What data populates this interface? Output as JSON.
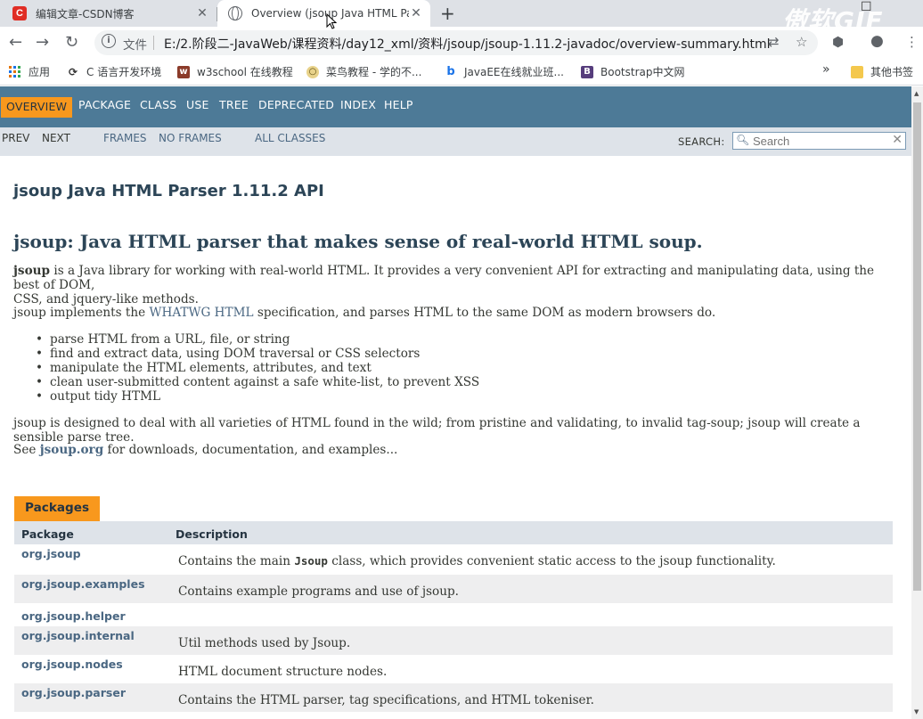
{
  "browser": {
    "tabs": [
      {
        "title": "编辑文章-CSDN博客",
        "icon": "csdn-icon",
        "active": false
      },
      {
        "title": "Overview (jsoup Java HTML Pa",
        "icon": "globe-icon",
        "active": true
      }
    ],
    "address": {
      "security_label": "文件",
      "url": "E:/2.阶段二-JavaWeb/课程资料/day12_xml/资料/jsoup/jsoup-1.11.2-javadoc/overview-summary.html"
    },
    "bookmarks": [
      {
        "label": "应用",
        "icon": "apps-grid-icon"
      },
      {
        "label": "C 语言开发环境",
        "icon": "sync-icon"
      },
      {
        "label": "w3school 在线教程",
        "icon": "w3school-icon"
      },
      {
        "label": "菜鸟教程 - 学的不...",
        "icon": "runoob-icon"
      },
      {
        "label": "JavaEE在线就业班...",
        "icon": "bing-icon"
      },
      {
        "label": "Bootstrap中文网",
        "icon": "bootstrap-icon"
      }
    ],
    "bookmarks_more": "»",
    "other_bookmarks": "其他书签",
    "watermark": "傲软GIF"
  },
  "javadoc": {
    "topnav": [
      "OVERVIEW",
      "PACKAGE",
      "CLASS",
      "USE",
      "TREE",
      "DEPRECATED",
      "INDEX",
      "HELP"
    ],
    "subnav": {
      "prev": "PREV",
      "next": "NEXT",
      "frames": "FRAMES",
      "no_frames": "NO FRAMES",
      "all_classes": "ALL CLASSES",
      "search_label": "SEARCH:",
      "search_placeholder": "Search"
    },
    "title": "jsoup Java HTML Parser 1.11.2 API",
    "heading": "jsoup: Java HTML parser that makes sense of real-world HTML soup.",
    "intro": {
      "bold": "jsoup",
      "line1": " is a Java library for working with real-world HTML. It provides a very convenient API for extracting and manipulating data, using the best of DOM,",
      "line2": "CSS, and jquery-like methods."
    },
    "implements": {
      "before": "jsoup implements the ",
      "link": "WHATWG HTML",
      "after": " specification, and parses HTML to the same DOM as modern browsers do."
    },
    "features": [
      "parse HTML from a URL, file, or string",
      "find and extract data, using DOM traversal or CSS selectors",
      "manipulate the HTML elements, attributes, and text",
      "clean user-submitted content against a safe white-list, to prevent XSS",
      "output tidy HTML"
    ],
    "designed": "jsoup is designed to deal with all varieties of HTML found in the wild; from pristine and validating, to invalid tag-soup; jsoup will create a sensible parse tree.",
    "see": {
      "before": "See ",
      "link": "jsoup.org",
      "after": " for downloads, documentation, and examples..."
    },
    "packages": {
      "tab": "Packages",
      "col_package": "Package",
      "col_description": "Description",
      "rows": [
        {
          "name": "org.jsoup",
          "desc_before": "Contains the main ",
          "desc_code": "Jsoup",
          "desc_after": " class, which provides convenient static access to the jsoup functionality."
        },
        {
          "name": "org.jsoup.examples",
          "desc_before": "Contains example programs and use of jsoup.",
          "desc_code": "",
          "desc_after": ""
        },
        {
          "name": "org.jsoup.helper",
          "desc_before": "",
          "desc_code": "",
          "desc_after": ""
        },
        {
          "name": "org.jsoup.internal",
          "desc_before": "Util methods used by Jsoup.",
          "desc_code": "",
          "desc_after": ""
        },
        {
          "name": "org.jsoup.nodes",
          "desc_before": "HTML document structure nodes.",
          "desc_code": "",
          "desc_after": ""
        },
        {
          "name": "org.jsoup.parser",
          "desc_before": "Contains the HTML parser, tag specifications, and HTML tokeniser.",
          "desc_code": "",
          "desc_after": ""
        }
      ]
    }
  },
  "colors": {
    "nav_bg": "#4d7a97",
    "nav_active": "#f8981d",
    "subnav_bg": "#dee3e9",
    "link": "#4a6782",
    "heading": "#2c4557",
    "text": "#353833"
  }
}
